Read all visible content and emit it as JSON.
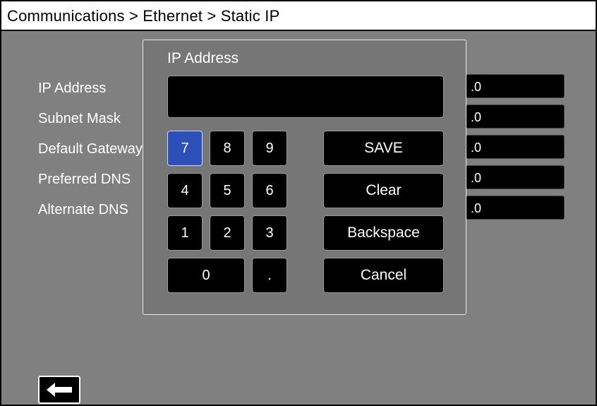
{
  "header": {
    "breadcrumb": "Communications > Ethernet > Static IP"
  },
  "settings": {
    "fields": [
      {
        "label": "IP Address",
        "value": ".0"
      },
      {
        "label": "Subnet Mask",
        "value": ".0"
      },
      {
        "label": "Default Gateway",
        "value": ".0"
      },
      {
        "label": "Preferred DNS",
        "value": ".0"
      },
      {
        "label": "Alternate DNS",
        "value": ".0"
      }
    ]
  },
  "dialog": {
    "title": "IP Address",
    "input_value": "",
    "keys": {
      "k7": "7",
      "k8": "8",
      "k9": "9",
      "k4": "4",
      "k5": "5",
      "k6": "6",
      "k1": "1",
      "k2": "2",
      "k3": "3",
      "k0": "0",
      "dot": "."
    },
    "actions": {
      "save": "SAVE",
      "clear": "Clear",
      "backspace": "Backspace",
      "cancel": "Cancel"
    }
  },
  "footer": {
    "back_icon": "arrow-left-icon"
  },
  "colors": {
    "background": "#808080",
    "dialog": "#767676",
    "selected_key": "#2d4fb8",
    "field_bg": "#000000"
  }
}
